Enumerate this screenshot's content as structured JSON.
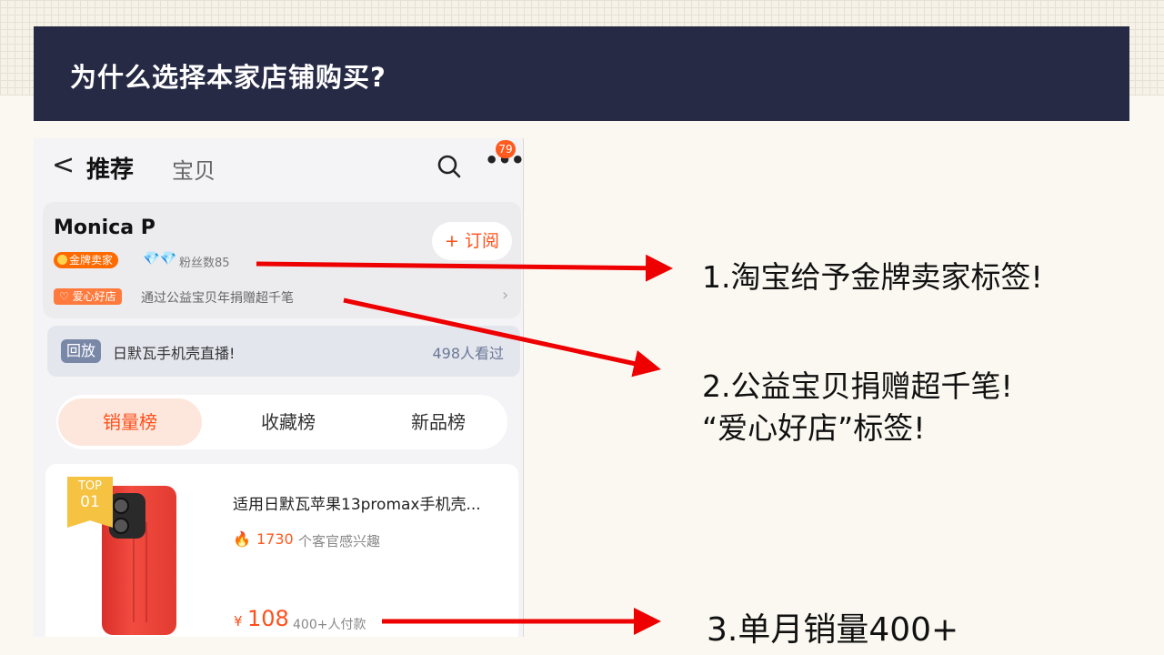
{
  "slide": {
    "title": "为什么选择本家店铺购买?"
  },
  "phone": {
    "nav": {
      "back": "<",
      "tab_active": "推荐",
      "tab": "宝贝",
      "badge": "79"
    },
    "shop": {
      "name": "Monica P",
      "subscribe": "+ 订阅",
      "gold_badge": "金牌卖家",
      "diamonds": "💎💎",
      "fans": "粉丝数85",
      "love_badge": "♡ 爱心好店",
      "love_text": "通过公益宝贝年捐赠超千笔",
      "chevron": "›"
    },
    "replay": {
      "tag": "回放",
      "text": "日默瓦手机壳直播!",
      "count": "498人看过"
    },
    "rank_tabs": [
      "销量榜",
      "收藏榜",
      "新品榜"
    ],
    "product": {
      "flag_top": "TOP",
      "flag_num": "01",
      "title": "适用日默瓦苹果13promax手机壳...",
      "fire_icon": "🔥",
      "interest_num": "1730",
      "interest_text": "个客官感兴趣",
      "price_symbol": "¥",
      "price": "108",
      "paid": "400+人付款"
    }
  },
  "callouts": {
    "c1": "1.淘宝给予金牌卖家标签!",
    "c2_line1": "2.公益宝贝捐赠超千笔!",
    "c2_line2": "“爱心好店”标签!",
    "c3": "3.单月销量400+"
  },
  "colors": {
    "banner": "#272a45",
    "arrow": "#ee0000",
    "accent": "#ff4f1a"
  }
}
